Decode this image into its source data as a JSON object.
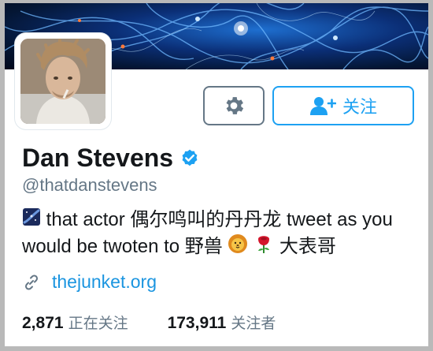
{
  "profile": {
    "name": "Dan Stevens",
    "handle": "@thatdanstevens",
    "verified_color": "#1da1f2",
    "follow_label": "关注",
    "bio": {
      "part1": "that actor 偶尔鸣叫的丹丹龙 tweet as you would be twoten to 野兽",
      "part2": "大表哥"
    },
    "website": "thejunket.org"
  },
  "stats": {
    "following_count": "2,871",
    "following_label": "正在关注",
    "followers_count": "173,911",
    "followers_label": "关注者"
  },
  "colors": {
    "accent": "#1da1f2",
    "text": "#14171a",
    "muted": "#657786",
    "link": "#1b95e0"
  },
  "icons": [
    "gear-icon",
    "add-user-icon",
    "verified-badge-icon",
    "link-icon",
    "galaxy-emoji-icon",
    "lion-emoji-icon",
    "rose-emoji-icon"
  ]
}
